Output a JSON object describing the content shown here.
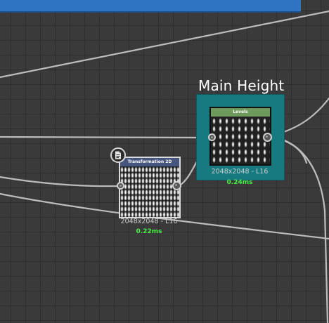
{
  "window": {
    "accent_bar_color": "#2f74c3",
    "canvas_color": "#3a3a3a",
    "grid_color": "#2e2e2e"
  },
  "frame": {
    "title": "Main Height",
    "color": "#177a80"
  },
  "nodes": {
    "levels": {
      "title": "Levels",
      "header_color": "#6e9a5c",
      "resolution": "2048x2048 - L16",
      "time": "0.24ms"
    },
    "transformation_2d": {
      "title": "Transformation 2D",
      "header_color": "#46557e",
      "resolution": "2048x2048 - L16",
      "time": "0.22ms",
      "badge_icon": "document-icon"
    }
  },
  "colors": {
    "wire": "#bdbdbd",
    "time_text": "#46f146",
    "info_text": "#cfcfcf"
  }
}
